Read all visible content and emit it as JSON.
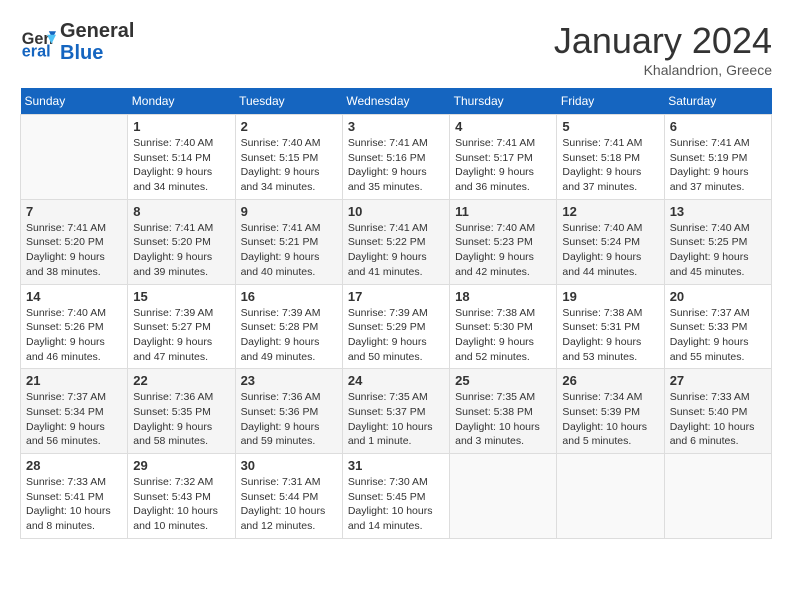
{
  "header": {
    "logo_line1": "General",
    "logo_line2": "Blue",
    "month_title": "January 2024",
    "location": "Khalandrion, Greece"
  },
  "days_of_week": [
    "Sunday",
    "Monday",
    "Tuesday",
    "Wednesday",
    "Thursday",
    "Friday",
    "Saturday"
  ],
  "weeks": [
    [
      {
        "day": "",
        "info": ""
      },
      {
        "day": "1",
        "info": "Sunrise: 7:40 AM\nSunset: 5:14 PM\nDaylight: 9 hours\nand 34 minutes."
      },
      {
        "day": "2",
        "info": "Sunrise: 7:40 AM\nSunset: 5:15 PM\nDaylight: 9 hours\nand 34 minutes."
      },
      {
        "day": "3",
        "info": "Sunrise: 7:41 AM\nSunset: 5:16 PM\nDaylight: 9 hours\nand 35 minutes."
      },
      {
        "day": "4",
        "info": "Sunrise: 7:41 AM\nSunset: 5:17 PM\nDaylight: 9 hours\nand 36 minutes."
      },
      {
        "day": "5",
        "info": "Sunrise: 7:41 AM\nSunset: 5:18 PM\nDaylight: 9 hours\nand 37 minutes."
      },
      {
        "day": "6",
        "info": "Sunrise: 7:41 AM\nSunset: 5:19 PM\nDaylight: 9 hours\nand 37 minutes."
      }
    ],
    [
      {
        "day": "7",
        "info": "Sunrise: 7:41 AM\nSunset: 5:20 PM\nDaylight: 9 hours\nand 38 minutes."
      },
      {
        "day": "8",
        "info": "Sunrise: 7:41 AM\nSunset: 5:20 PM\nDaylight: 9 hours\nand 39 minutes."
      },
      {
        "day": "9",
        "info": "Sunrise: 7:41 AM\nSunset: 5:21 PM\nDaylight: 9 hours\nand 40 minutes."
      },
      {
        "day": "10",
        "info": "Sunrise: 7:41 AM\nSunset: 5:22 PM\nDaylight: 9 hours\nand 41 minutes."
      },
      {
        "day": "11",
        "info": "Sunrise: 7:40 AM\nSunset: 5:23 PM\nDaylight: 9 hours\nand 42 minutes."
      },
      {
        "day": "12",
        "info": "Sunrise: 7:40 AM\nSunset: 5:24 PM\nDaylight: 9 hours\nand 44 minutes."
      },
      {
        "day": "13",
        "info": "Sunrise: 7:40 AM\nSunset: 5:25 PM\nDaylight: 9 hours\nand 45 minutes."
      }
    ],
    [
      {
        "day": "14",
        "info": "Sunrise: 7:40 AM\nSunset: 5:26 PM\nDaylight: 9 hours\nand 46 minutes."
      },
      {
        "day": "15",
        "info": "Sunrise: 7:39 AM\nSunset: 5:27 PM\nDaylight: 9 hours\nand 47 minutes."
      },
      {
        "day": "16",
        "info": "Sunrise: 7:39 AM\nSunset: 5:28 PM\nDaylight: 9 hours\nand 49 minutes."
      },
      {
        "day": "17",
        "info": "Sunrise: 7:39 AM\nSunset: 5:29 PM\nDaylight: 9 hours\nand 50 minutes."
      },
      {
        "day": "18",
        "info": "Sunrise: 7:38 AM\nSunset: 5:30 PM\nDaylight: 9 hours\nand 52 minutes."
      },
      {
        "day": "19",
        "info": "Sunrise: 7:38 AM\nSunset: 5:31 PM\nDaylight: 9 hours\nand 53 minutes."
      },
      {
        "day": "20",
        "info": "Sunrise: 7:37 AM\nSunset: 5:33 PM\nDaylight: 9 hours\nand 55 minutes."
      }
    ],
    [
      {
        "day": "21",
        "info": "Sunrise: 7:37 AM\nSunset: 5:34 PM\nDaylight: 9 hours\nand 56 minutes."
      },
      {
        "day": "22",
        "info": "Sunrise: 7:36 AM\nSunset: 5:35 PM\nDaylight: 9 hours\nand 58 minutes."
      },
      {
        "day": "23",
        "info": "Sunrise: 7:36 AM\nSunset: 5:36 PM\nDaylight: 9 hours\nand 59 minutes."
      },
      {
        "day": "24",
        "info": "Sunrise: 7:35 AM\nSunset: 5:37 PM\nDaylight: 10 hours\nand 1 minute."
      },
      {
        "day": "25",
        "info": "Sunrise: 7:35 AM\nSunset: 5:38 PM\nDaylight: 10 hours\nand 3 minutes."
      },
      {
        "day": "26",
        "info": "Sunrise: 7:34 AM\nSunset: 5:39 PM\nDaylight: 10 hours\nand 5 minutes."
      },
      {
        "day": "27",
        "info": "Sunrise: 7:33 AM\nSunset: 5:40 PM\nDaylight: 10 hours\nand 6 minutes."
      }
    ],
    [
      {
        "day": "28",
        "info": "Sunrise: 7:33 AM\nSunset: 5:41 PM\nDaylight: 10 hours\nand 8 minutes."
      },
      {
        "day": "29",
        "info": "Sunrise: 7:32 AM\nSunset: 5:43 PM\nDaylight: 10 hours\nand 10 minutes."
      },
      {
        "day": "30",
        "info": "Sunrise: 7:31 AM\nSunset: 5:44 PM\nDaylight: 10 hours\nand 12 minutes."
      },
      {
        "day": "31",
        "info": "Sunrise: 7:30 AM\nSunset: 5:45 PM\nDaylight: 10 hours\nand 14 minutes."
      },
      {
        "day": "",
        "info": ""
      },
      {
        "day": "",
        "info": ""
      },
      {
        "day": "",
        "info": ""
      }
    ]
  ]
}
